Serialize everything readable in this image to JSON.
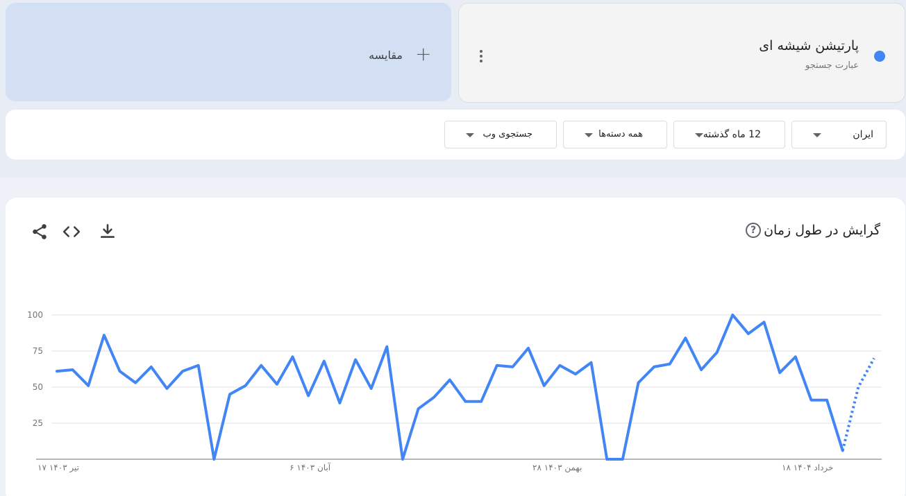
{
  "term": {
    "title": "پارتیشن شیشه ای",
    "subtitle": "عبارت جستجو",
    "color": "#4285f4"
  },
  "compare": {
    "label": "مقایسه"
  },
  "filters": [
    {
      "label": "ایران"
    },
    {
      "label": "12 ماه گذشته"
    },
    {
      "label": "همه دسته‌ها"
    },
    {
      "label": "جستجوی وب"
    }
  ],
  "chart_section": {
    "title": "گرایش در طول زمان"
  },
  "icons": {
    "share": "share-icon",
    "embed": "code-icon",
    "download": "download-icon",
    "help": "help-icon",
    "menu": "more-vert-icon",
    "add": "plus-icon"
  },
  "chart_data": {
    "type": "line",
    "title": "",
    "xlabel": "",
    "ylabel": "",
    "ylim": [
      0,
      100
    ],
    "yticks": [
      25,
      50,
      75,
      100
    ],
    "grid": true,
    "x_tick_labels": [
      {
        "index": 0,
        "label": "۱۷ تیر ۱۴۰۳"
      },
      {
        "index": 16,
        "label": "۶ آبان ۱۴۰۳"
      },
      {
        "index": 32,
        "label": "۲۸ بهمن ۱۴۰۳"
      },
      {
        "index": 48,
        "label": "۱۸ خرداد ۱۴۰۴"
      }
    ],
    "series": [
      {
        "color": "#4285f4",
        "values": [
          61,
          62,
          51,
          86,
          61,
          53,
          64,
          49,
          61,
          65,
          0,
          45,
          51,
          65,
          52,
          71,
          44,
          68,
          39,
          69,
          49,
          78,
          0,
          35,
          43,
          55,
          40,
          40,
          65,
          64,
          77,
          51,
          65,
          59,
          67,
          0,
          0,
          53,
          64,
          66,
          84,
          62,
          74,
          100,
          87,
          95,
          60,
          71,
          41,
          41,
          6,
          50,
          70
        ],
        "partial_from_index": 51
      }
    ]
  }
}
